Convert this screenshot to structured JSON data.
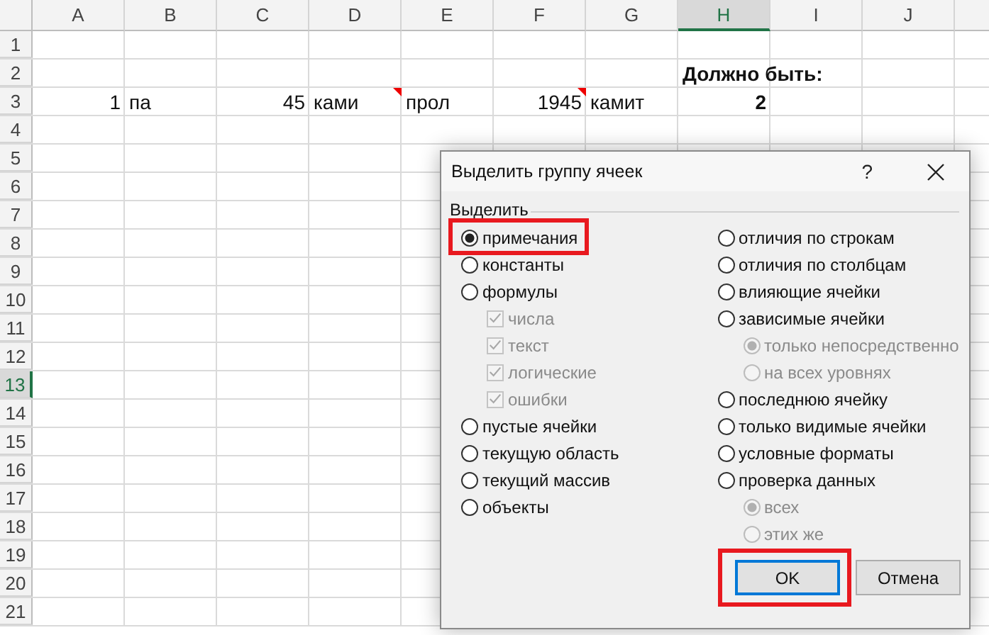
{
  "sheet": {
    "columns": [
      {
        "label": "A",
        "selected": false
      },
      {
        "label": "B",
        "selected": false
      },
      {
        "label": "C",
        "selected": false
      },
      {
        "label": "D",
        "selected": false
      },
      {
        "label": "E",
        "selected": false
      },
      {
        "label": "F",
        "selected": false
      },
      {
        "label": "G",
        "selected": false
      },
      {
        "label": "H",
        "selected": true
      },
      {
        "label": "I",
        "selected": false
      },
      {
        "label": "J",
        "selected": false
      }
    ],
    "rows": [
      {
        "header": "1",
        "selected": false
      },
      {
        "header": "2",
        "selected": false,
        "cells": {
          "H": {
            "text": "Должно быть:",
            "kind": "text",
            "bold": true
          }
        }
      },
      {
        "header": "3",
        "selected": false,
        "cells": {
          "A": {
            "text": "1",
            "kind": "number"
          },
          "B": {
            "text": "па",
            "kind": "text"
          },
          "C": {
            "text": "45",
            "kind": "number"
          },
          "D": {
            "text": "ками",
            "kind": "text",
            "comment": true
          },
          "E": {
            "text": "прол",
            "kind": "text"
          },
          "F": {
            "text": "1945",
            "kind": "number",
            "comment": true
          },
          "G": {
            "text": "камит",
            "kind": "text"
          },
          "H": {
            "text": "2",
            "kind": "number",
            "bold": true
          }
        }
      },
      {
        "header": "4",
        "selected": false
      },
      {
        "header": "5",
        "selected": false
      },
      {
        "header": "6",
        "selected": false
      },
      {
        "header": "7",
        "selected": false
      },
      {
        "header": "8",
        "selected": false
      },
      {
        "header": "9",
        "selected": false
      },
      {
        "header": "10",
        "selected": false
      },
      {
        "header": "11",
        "selected": false
      },
      {
        "header": "12",
        "selected": false
      },
      {
        "header": "13",
        "selected": true
      },
      {
        "header": "14",
        "selected": false
      },
      {
        "header": "15",
        "selected": false
      },
      {
        "header": "16",
        "selected": false
      },
      {
        "header": "17",
        "selected": false
      },
      {
        "header": "18",
        "selected": false
      },
      {
        "header": "19",
        "selected": false
      },
      {
        "header": "20",
        "selected": false
      },
      {
        "header": "21",
        "selected": false
      }
    ]
  },
  "dialog": {
    "title": "Выделить группу ячеек",
    "help": "?",
    "group_label": "Выделить",
    "left_options": [
      {
        "kind": "radio",
        "label": "примечания",
        "selected": true,
        "highlighted": true
      },
      {
        "kind": "radio",
        "label": "константы",
        "selected": false,
        "highlighted": false
      },
      {
        "kind": "radio",
        "label": "формулы",
        "selected": false,
        "highlighted": false,
        "children": [
          {
            "kind": "checkbox",
            "label": "числа",
            "checked": true,
            "disabled": true
          },
          {
            "kind": "checkbox",
            "label": "текст",
            "checked": true,
            "disabled": true
          },
          {
            "kind": "checkbox",
            "label": "логические",
            "checked": true,
            "disabled": true
          },
          {
            "kind": "checkbox",
            "label": "ошибки",
            "checked": true,
            "disabled": true
          }
        ]
      },
      {
        "kind": "radio",
        "label": "пустые ячейки",
        "selected": false,
        "highlighted": false
      },
      {
        "kind": "radio",
        "label": "текущую область",
        "selected": false,
        "highlighted": false
      },
      {
        "kind": "radio",
        "label": "текущий массив",
        "selected": false,
        "highlighted": false
      },
      {
        "kind": "radio",
        "label": "объекты",
        "selected": false,
        "highlighted": false
      }
    ],
    "right_options": [
      {
        "kind": "radio",
        "label": "отличия по строкам",
        "selected": false,
        "highlighted": false
      },
      {
        "kind": "radio",
        "label": "отличия по столбцам",
        "selected": false,
        "highlighted": false
      },
      {
        "kind": "radio",
        "label": "влияющие ячейки",
        "selected": false,
        "highlighted": false
      },
      {
        "kind": "radio",
        "label": "зависимые ячейки",
        "selected": false,
        "highlighted": false,
        "children": [
          {
            "kind": "radio",
            "label": "только непосредственно",
            "selected": true,
            "disabled": true
          },
          {
            "kind": "radio",
            "label": "на всех уровнях",
            "selected": false,
            "disabled": true
          }
        ]
      },
      {
        "kind": "radio",
        "label": "последнюю ячейку",
        "selected": false,
        "highlighted": false
      },
      {
        "kind": "radio",
        "label": "только видимые ячейки",
        "selected": false,
        "highlighted": false
      },
      {
        "kind": "radio",
        "label": "условные форматы",
        "selected": false,
        "highlighted": false
      },
      {
        "kind": "radio",
        "label": "проверка данных",
        "selected": false,
        "highlighted": false,
        "children": [
          {
            "kind": "radio",
            "label": "всех",
            "selected": true,
            "disabled": true
          },
          {
            "kind": "radio",
            "label": "этих же",
            "selected": false,
            "disabled": true
          }
        ]
      }
    ],
    "buttons": [
      {
        "label": "OK",
        "default": true,
        "highlighted": true
      },
      {
        "label": "Отмена",
        "default": false,
        "highlighted": false
      }
    ]
  }
}
